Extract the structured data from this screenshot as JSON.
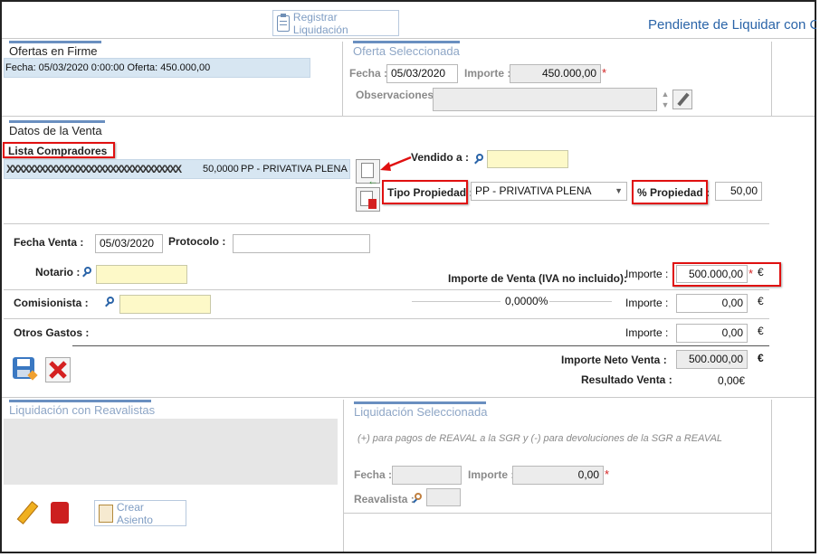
{
  "header": {
    "register_button_label": "Registrar Liquidación",
    "status_title": "Pendiente de Liquidar con CE"
  },
  "firm_offers": {
    "title": "Ofertas en Firme",
    "items": [
      "Fecha: 05/03/2020 0:00:00 Oferta: 450.000,00"
    ]
  },
  "selected_offer": {
    "title": "Oferta Seleccionada",
    "date_label": "Fecha :",
    "date_value": "05/03/2020",
    "amount_label": "Importe :",
    "amount_value": "450.000,00",
    "required_mark": "*",
    "observations_label": "Observaciones :",
    "observations_value": ""
  },
  "sale_data": {
    "title": "Datos de la Venta",
    "buyers_list_label": "Lista Compradores",
    "buyers": [
      {
        "name": "XXXXXXXXXXXXXXXXXXXXXXXXXXXXXXXX",
        "percent": "50,0000",
        "ownership": "PP - PRIVATIVA PLENA"
      }
    ],
    "sold_to_label": "Vendido a :",
    "sold_to_value": "",
    "ownership_type_label": "Tipo Propiedad :",
    "ownership_type_value": "PP - PRIVATIVA PLENA",
    "ownership_percent_label": "% Propiedad :",
    "ownership_percent_value": "50,00",
    "sale_date_label": "Fecha Venta :",
    "sale_date_value": "05/03/2020",
    "protocol_label": "Protocolo :",
    "protocol_value": "",
    "notary_label": "Notario :",
    "notary_value": "",
    "sale_amount_label": "Importe de Venta (IVA no incluido):",
    "amount_label": "Importe :",
    "sale_amount_value": "500.000,00",
    "currency": "€",
    "required_mark": "*",
    "commission_label": "Comisionista :",
    "commission_value": "",
    "commission_percent": "0,0000%",
    "commission_amount": "0,00",
    "other_expenses_label": "Otros Gastos :",
    "other_expenses_amount": "0,00",
    "net_sale_label": "Importe Neto Venta :",
    "net_sale_value": "500.000,00",
    "result_label": "Resultado Venta :",
    "result_value": "0,00€"
  },
  "reavalistas": {
    "title": "Liquidación con Reavalistas",
    "create_entry_label": "Crear Asiento"
  },
  "selected_liquidation": {
    "title": "Liquidación Seleccionada",
    "hint": "(+) para pagos de REAVAL a la SGR y (-) para devoluciones de la SGR a REAVAL",
    "date_label": "Fecha :",
    "date_value": "",
    "amount_label": "Importe :",
    "amount_value": "0,00",
    "required_mark": "*",
    "reavalista_label": "Reavalista :",
    "reavalista_value": ""
  },
  "colors": {
    "accent_blue": "#2a64a8",
    "highlight_red": "#e01010",
    "required_red": "#d21f1f",
    "selected_row": "#d7e6f2",
    "yellow_input": "#fdf9c8"
  }
}
